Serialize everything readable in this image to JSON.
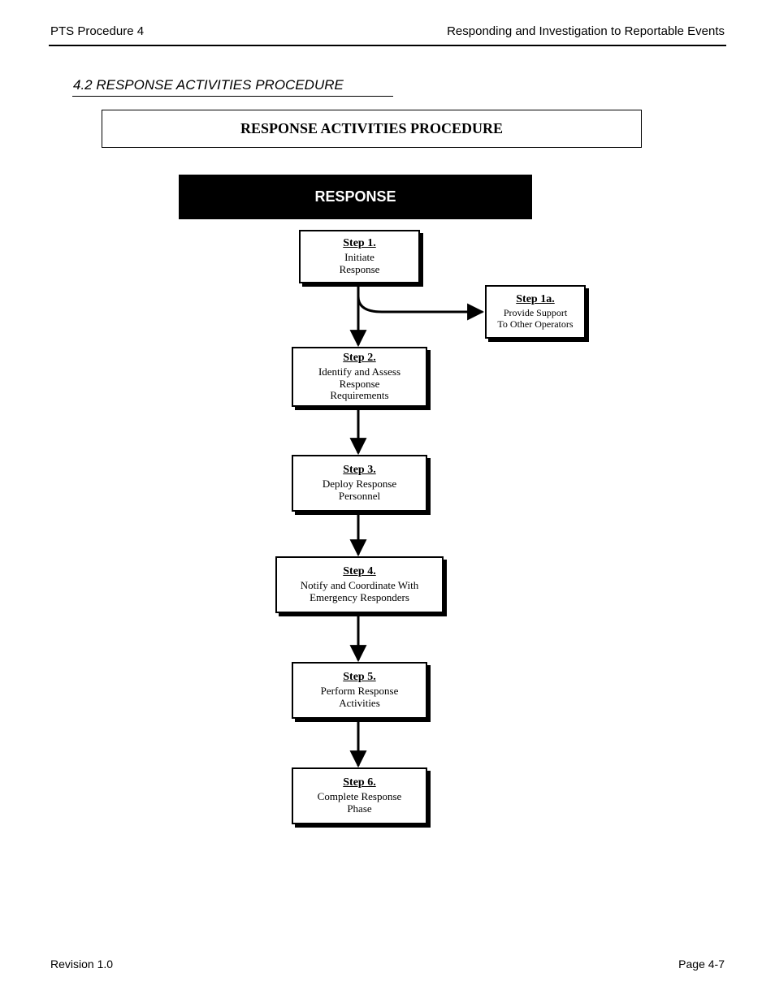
{
  "header": {
    "left": "PTS Procedure 4",
    "right": "Responding and Investigation to Reportable Events"
  },
  "section": {
    "title": "4.2  RESPONSE ACTIVITIES PROCEDURE",
    "box_title": "RESPONSE ACTIVITIES PROCEDURE",
    "phase_label": "RESPONSE"
  },
  "flow": {
    "steps": [
      {
        "id": "step1",
        "label": "Step 1.",
        "text": "Initiate\nResponse"
      },
      {
        "id": "step1a",
        "label": "Step 1a.",
        "text": "Provide Support\nTo Other Operators"
      },
      {
        "id": "step2",
        "label": "Step 2.",
        "text": "Identify and Assess\nResponse\nRequirements"
      },
      {
        "id": "step3",
        "label": "Step 3.",
        "text": "Deploy Response\nPersonnel"
      },
      {
        "id": "step4",
        "label": "Step 4.",
        "text": "Notify and Coordinate With\nEmergency Responders"
      },
      {
        "id": "step5",
        "label": "Step 5.",
        "text": "Perform Response\nActivities"
      },
      {
        "id": "step6",
        "label": "Step 6.",
        "text": "Complete Response\nPhase"
      }
    ]
  },
  "footer": {
    "left": "Revision 1.0",
    "right": "Page 4-7"
  }
}
